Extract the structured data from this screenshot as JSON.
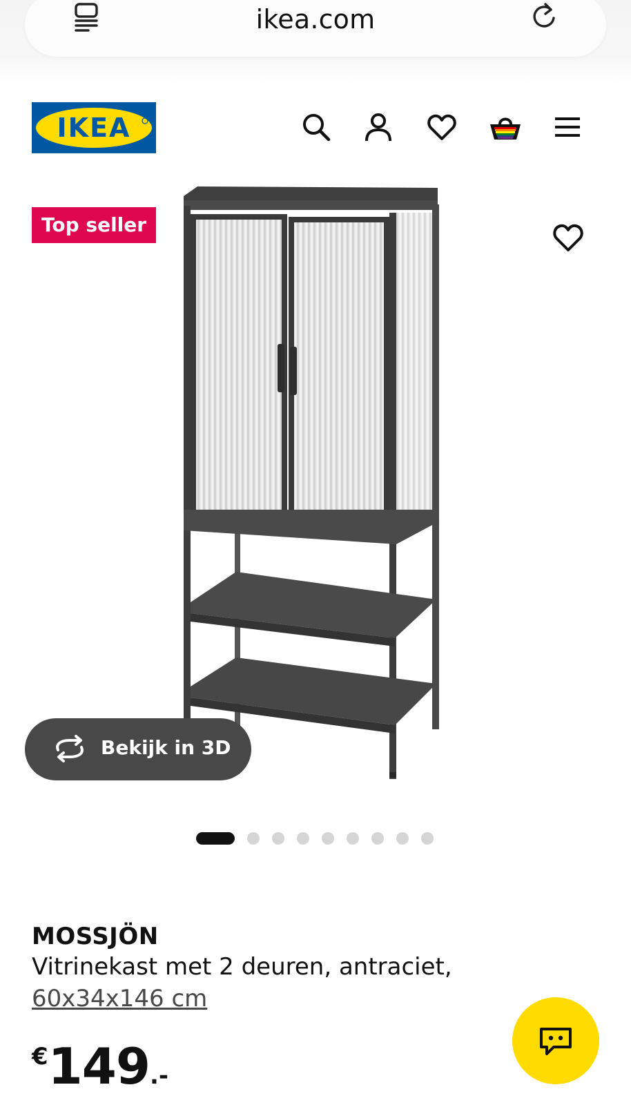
{
  "browser": {
    "url": "ikea.com",
    "icons": {
      "tabs": "tabs-icon",
      "reload": "reload-icon"
    }
  },
  "header": {
    "logo_text": "IKEA",
    "icons": [
      "search-icon",
      "account-icon",
      "heart-icon",
      "basket-icon",
      "menu-icon"
    ],
    "colors": {
      "logo_blue": "#0058a3",
      "logo_yellow": "#ffdb00"
    }
  },
  "product_media": {
    "badge": "Top seller",
    "badge_color": "#e00751",
    "view_3d_label": "Bekijk in 3D",
    "carousel": {
      "total": 9,
      "active_index": 0
    }
  },
  "product": {
    "name": "MOSSJÖN",
    "description": "Vitrinekast met 2 deuren, antraciet,",
    "dimensions": "60x34x146 cm",
    "price": {
      "currency": "€",
      "amount": "149",
      "suffix": ".-"
    }
  },
  "chat": {
    "icon": "chat-icon",
    "color": "#ffdb00"
  }
}
